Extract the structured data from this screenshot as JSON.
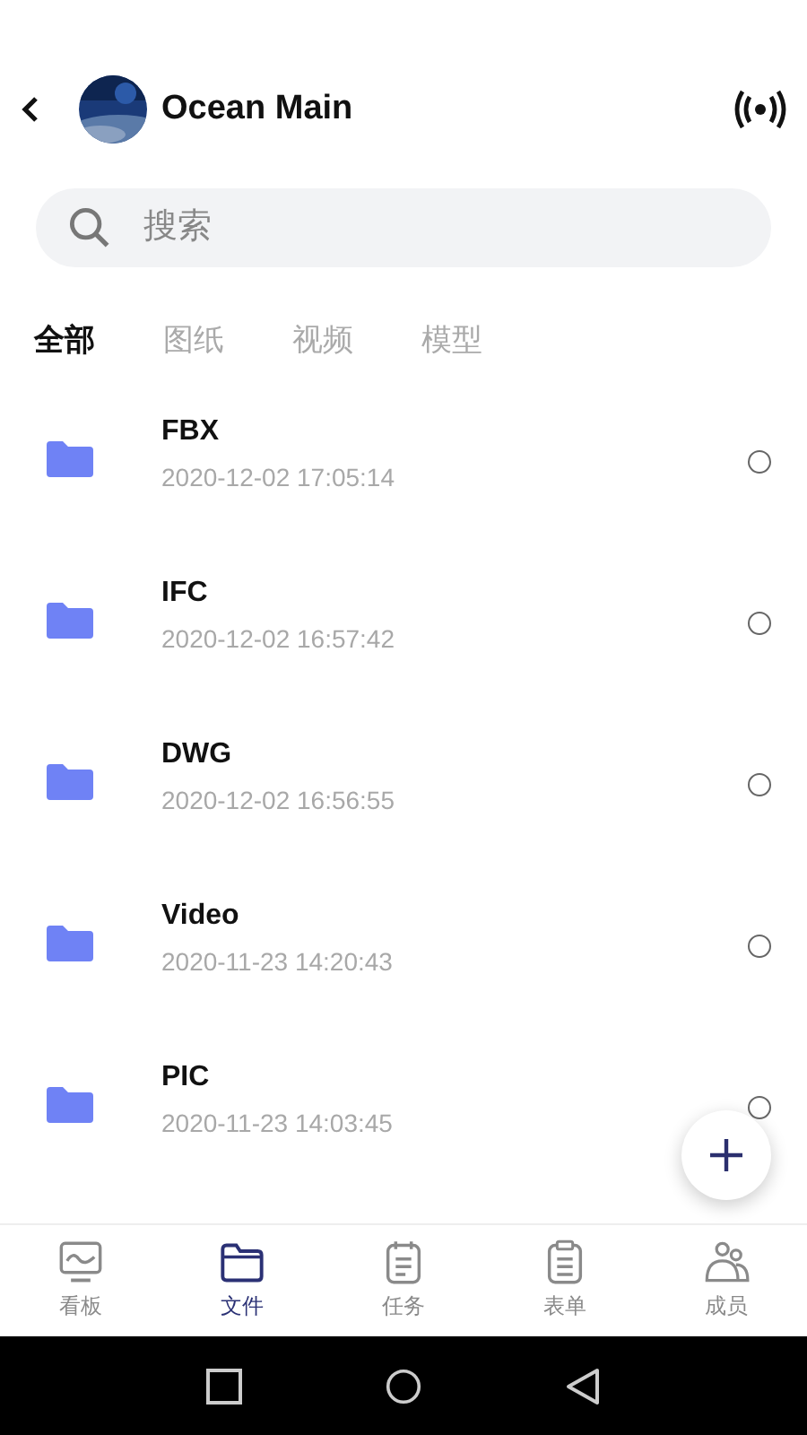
{
  "header": {
    "title": "Ocean Main"
  },
  "search": {
    "placeholder": "搜索"
  },
  "tabs": [
    {
      "label": "全部",
      "selected": true
    },
    {
      "label": "图纸",
      "selected": false
    },
    {
      "label": "视频",
      "selected": false
    },
    {
      "label": "模型",
      "selected": false
    }
  ],
  "files": [
    {
      "name": "FBX",
      "date": "2020-12-02 17:05:14",
      "selected": false
    },
    {
      "name": "IFC",
      "date": "2020-12-02 16:57:42",
      "selected": false
    },
    {
      "name": "DWG",
      "date": "2020-12-02 16:56:55",
      "selected": false
    },
    {
      "name": "Video",
      "date": "2020-11-23 14:20:43",
      "selected": false
    },
    {
      "name": "PIC",
      "date": "2020-11-23 14:03:45",
      "selected": false
    }
  ],
  "bottom_nav": [
    {
      "label": "看板",
      "kind": "board",
      "selected": false
    },
    {
      "label": "文件",
      "kind": "folder",
      "selected": true
    },
    {
      "label": "任务",
      "kind": "task",
      "selected": false
    },
    {
      "label": "表单",
      "kind": "form",
      "selected": false
    },
    {
      "label": "成员",
      "kind": "members",
      "selected": false
    }
  ]
}
